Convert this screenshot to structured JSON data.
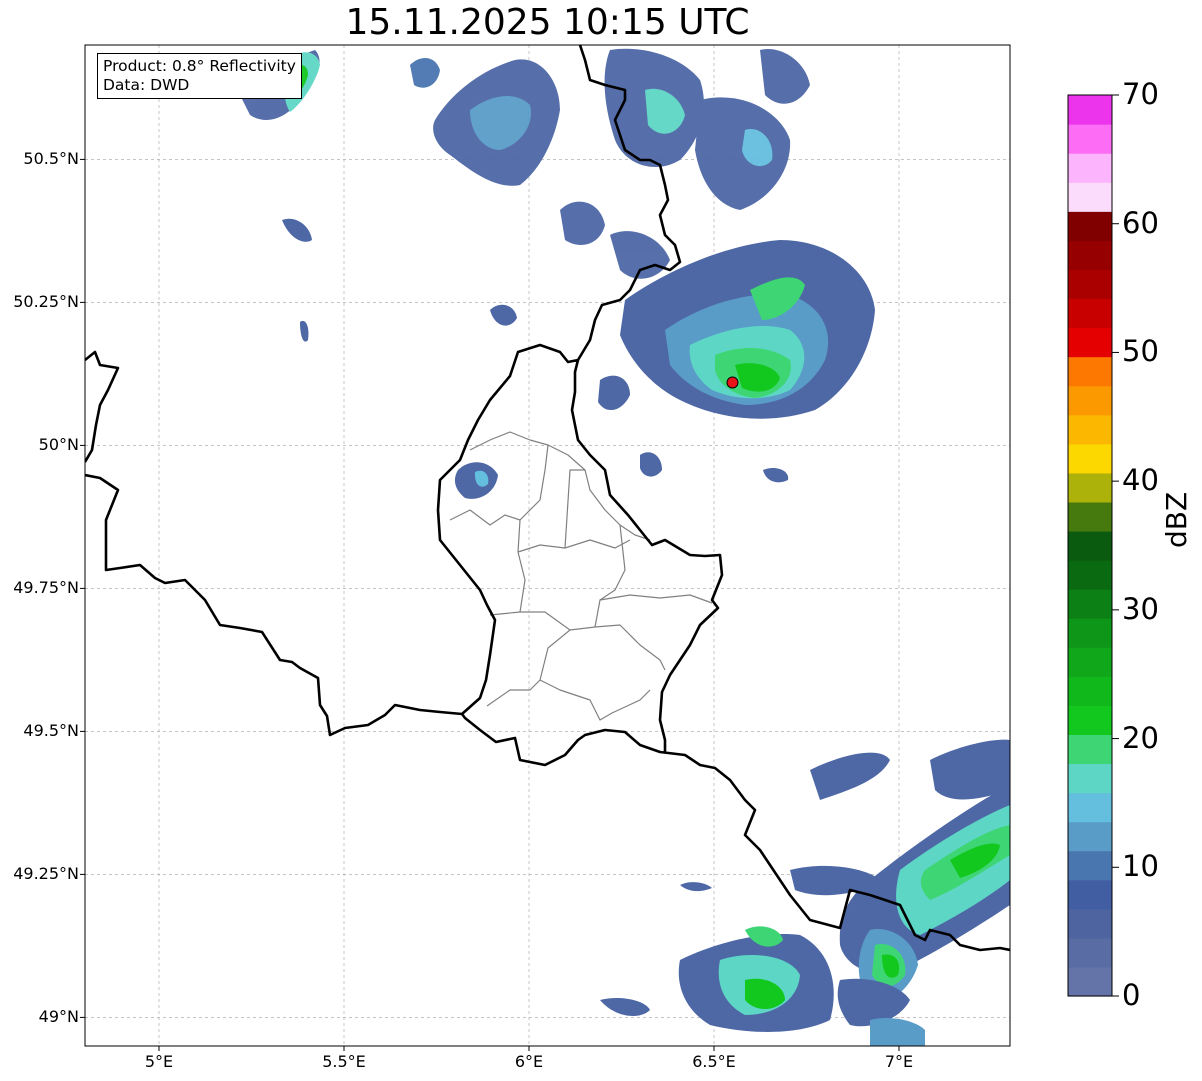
{
  "title": "15.11.2025 10:15 UTC",
  "info": {
    "product": "Product: 0.8° Reflectivity",
    "data": "Data: DWD"
  },
  "map": {
    "extent": {
      "lon": [
        4.8,
        7.3
      ],
      "lat": [
        48.95,
        50.7
      ]
    },
    "lat_ticks": [
      {
        "value": 50.5,
        "label": "50.5°N"
      },
      {
        "value": 50.25,
        "label": "50.25°N"
      },
      {
        "value": 50.0,
        "label": "50°N"
      },
      {
        "value": 49.75,
        "label": "49.75°N"
      },
      {
        "value": 49.5,
        "label": "49.5°N"
      },
      {
        "value": 49.25,
        "label": "49.25°N"
      },
      {
        "value": 49.0,
        "label": "49°N"
      }
    ],
    "lon_ticks": [
      {
        "value": 5.0,
        "label": "5°E"
      },
      {
        "value": 5.5,
        "label": "5.5°E"
      },
      {
        "value": 6.0,
        "label": "6°E"
      },
      {
        "value": 6.5,
        "label": "6.5°E"
      },
      {
        "value": 7.0,
        "label": "7°E"
      }
    ],
    "grid": true,
    "radar_site": {
      "lon": 6.55,
      "lat": 50.11,
      "color": "#e8141a"
    }
  },
  "colorbar": {
    "label": "dBZ",
    "min": 0,
    "max": 70,
    "ticks": [
      "70",
      "60",
      "50",
      "40",
      "30",
      "20",
      "10",
      "0"
    ],
    "colors": [
      "#6474a8",
      "#5a6ca4",
      "#4e64a0",
      "#425ea2",
      "#4a76b0",
      "#5a9cc8",
      "#64bede",
      "#5ed6c6",
      "#3ed674",
      "#12c81e",
      "#10b81c",
      "#10a81a",
      "#0e9618",
      "#0c8014",
      "#0a6a12",
      "#0a5a10",
      "#467a0e",
      "#acb20a",
      "#fcd800",
      "#fcb800",
      "#fc9800",
      "#fc7800",
      "#e40000",
      "#c80000",
      "#aa0000",
      "#960000",
      "#800000",
      "#fcdcfc",
      "#fcb4fc",
      "#fc6cf4",
      "#ec34ec"
    ]
  }
}
